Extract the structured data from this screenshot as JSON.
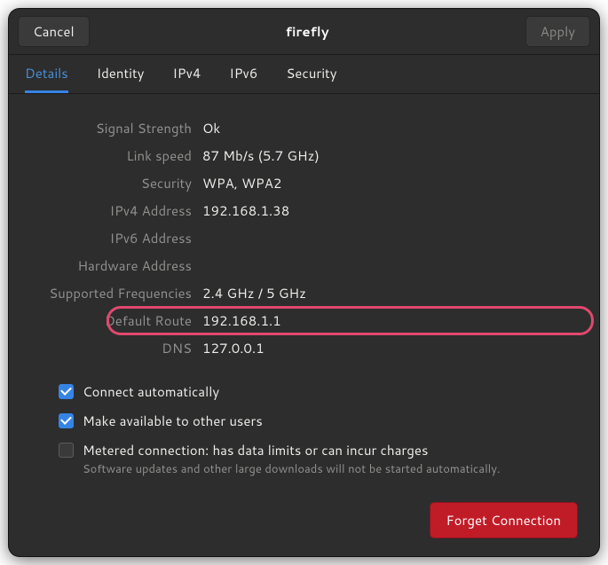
{
  "titlebar": {
    "cancel": "Cancel",
    "title": "firefly",
    "apply": "Apply"
  },
  "tabs": {
    "details": "Details",
    "identity": "Identity",
    "ipv4": "IPv4",
    "ipv6": "IPv6",
    "security": "Security"
  },
  "details": {
    "labels": {
      "signal": "Signal Strength",
      "speed": "Link speed",
      "security": "Security",
      "ipv4": "IPv4 Address",
      "ipv6": "IPv6 Address",
      "hw": "Hardware Address",
      "freq": "Supported Frequencies",
      "route": "Default Route",
      "dns": "DNS"
    },
    "values": {
      "signal": "Ok",
      "speed": "87 Mb/s (5.7 GHz)",
      "security": "WPA, WPA2",
      "ipv4": "192.168.1.38",
      "ipv6": "",
      "hw": "",
      "freq": "2.4 GHz / 5 GHz",
      "route": "192.168.1.1",
      "dns": "127.0.0.1"
    }
  },
  "checks": {
    "auto": "Connect automatically",
    "share": "Make available to other users",
    "metered": "Metered connection: has data limits or can incur charges",
    "metered_sub": "Software updates and other large downloads will not be started automatically."
  },
  "footer": {
    "forget": "Forget Connection"
  }
}
